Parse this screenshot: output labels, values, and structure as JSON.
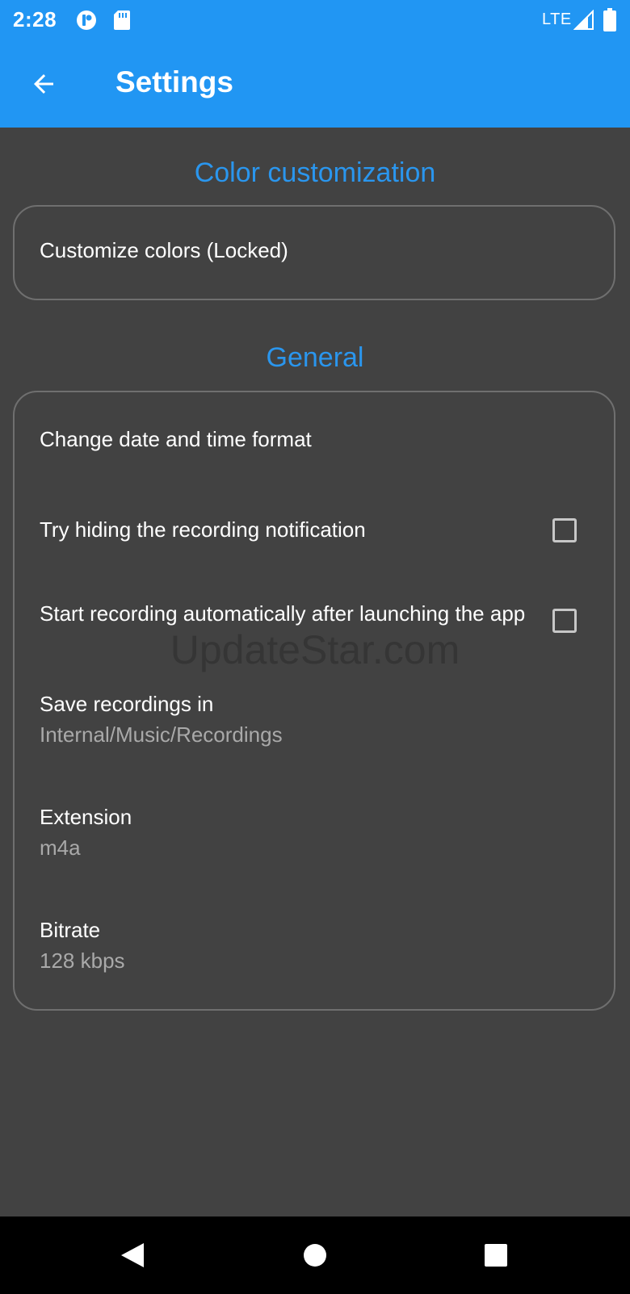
{
  "status_bar": {
    "time": "2:28",
    "network": "LTE",
    "icons": [
      "app-notification-icon",
      "sd-card-icon",
      "signal-icon",
      "battery-icon"
    ]
  },
  "app_bar": {
    "title": "Settings",
    "back_icon": "arrow-back-icon"
  },
  "sections": {
    "color": {
      "header": "Color customization",
      "items": {
        "customize": {
          "title": "Customize colors (Locked)"
        }
      }
    },
    "general": {
      "header": "General",
      "items": {
        "date_format": {
          "title": "Change date and time format"
        },
        "hide_notification": {
          "title": "Try hiding the recording notification",
          "checked": false
        },
        "autostart": {
          "title": "Start recording automatically after launching the app",
          "checked": false
        },
        "save_location": {
          "title": "Save recordings in",
          "value": "Internal/Music/Recordings"
        },
        "extension": {
          "title": "Extension",
          "value": "m4a"
        },
        "bitrate": {
          "title": "Bitrate",
          "value": "128 kbps"
        }
      }
    }
  },
  "watermark": "UpdateStar.com",
  "nav_bar": {
    "icons": [
      "back-triangle-icon",
      "home-circle-icon",
      "recents-square-icon"
    ]
  },
  "colors": {
    "accent": "#2196f3",
    "background": "#424242",
    "section_header": "#2a96ee",
    "subtitle": "#a9a9a9"
  }
}
